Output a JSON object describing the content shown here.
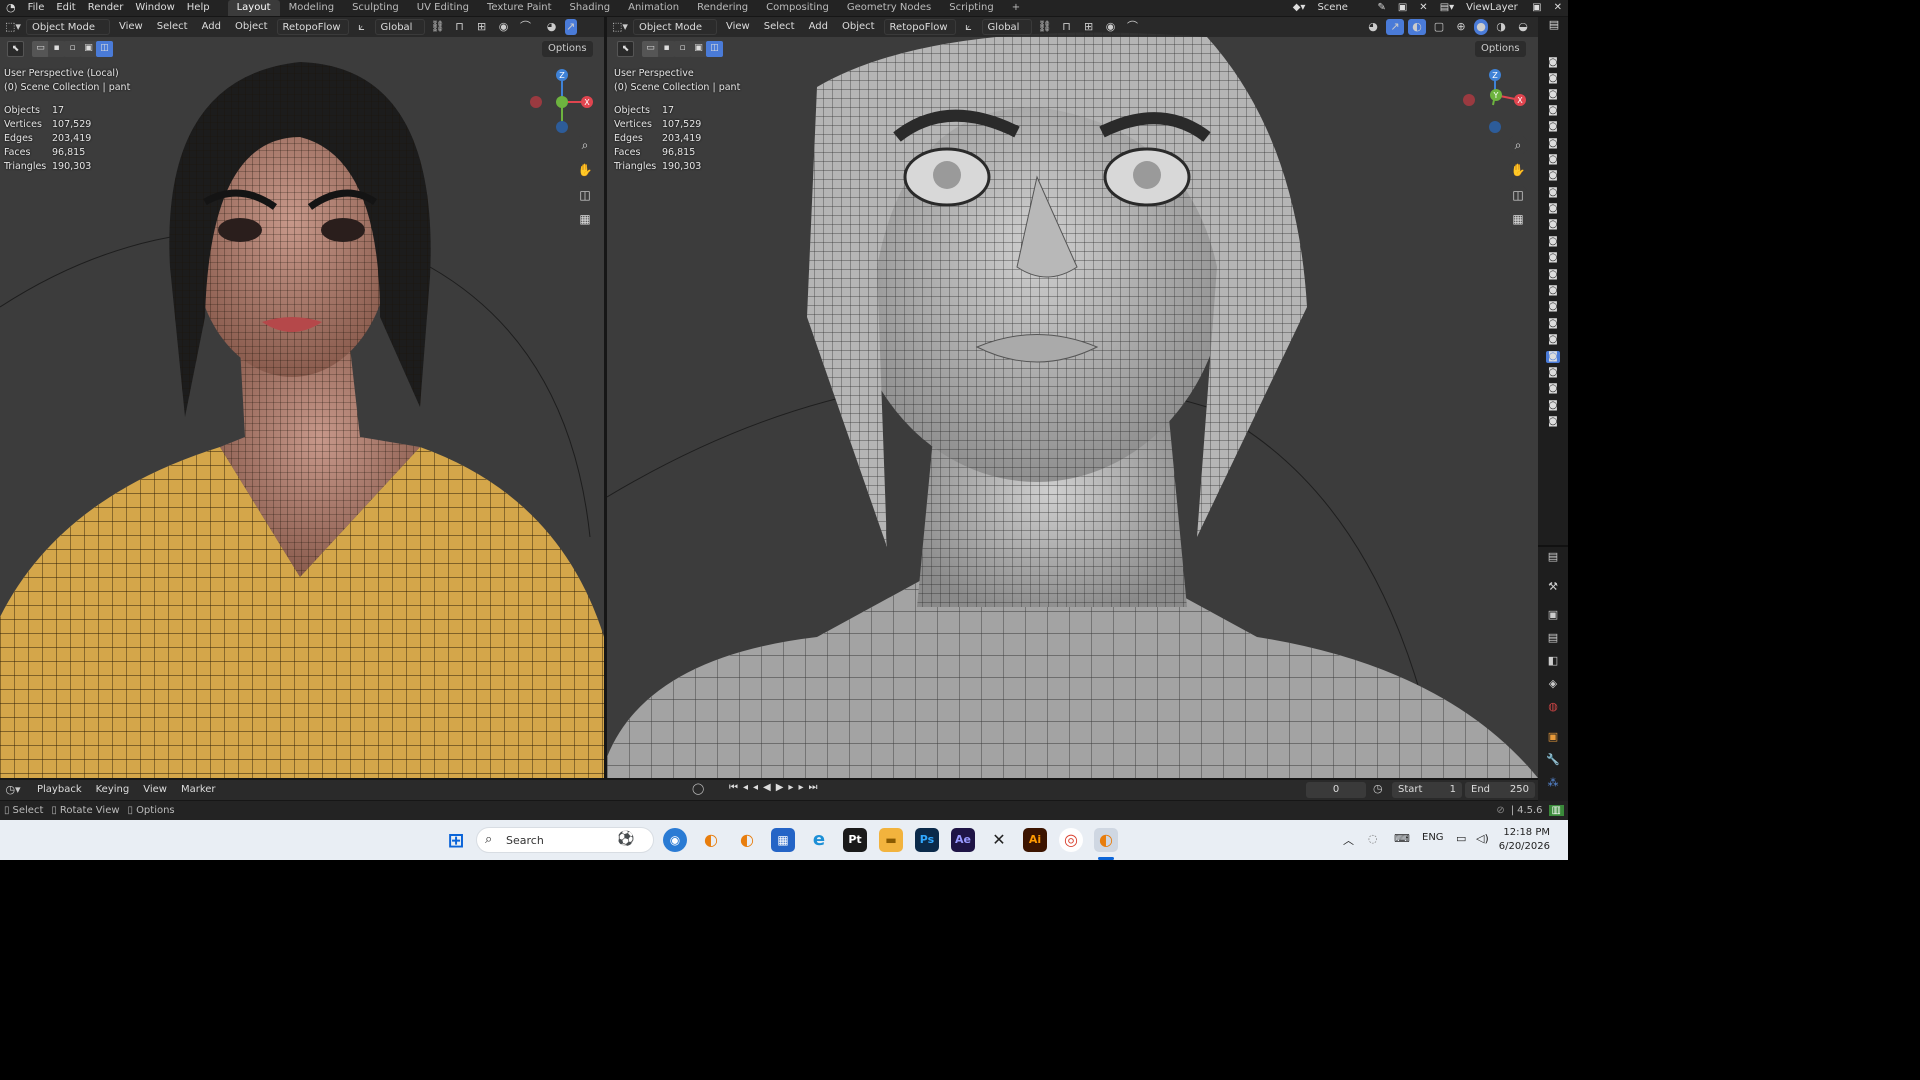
{
  "menu": {
    "items": [
      "File",
      "Edit",
      "Render",
      "Window",
      "Help"
    ],
    "workspaces": [
      "Layout",
      "Modeling",
      "Sculpting",
      "UV Editing",
      "Texture Paint",
      "Shading",
      "Animation",
      "Rendering",
      "Compositing",
      "Geometry Nodes",
      "Scripting"
    ],
    "active_workspace": "Layout",
    "scene_label": "Scene",
    "viewlayer_label": "ViewLayer"
  },
  "viewport_left": {
    "mode": "Object Mode",
    "menus": [
      "View",
      "Select",
      "Add",
      "Object"
    ],
    "addon": "RetopoFlow",
    "orientation": "Global",
    "options": "Options",
    "perspective": "User Perspective (Local)",
    "collection": "(0) Scene Collection | pant",
    "stats": [
      {
        "k": "Objects",
        "v": "17"
      },
      {
        "k": "Vertices",
        "v": "107,529"
      },
      {
        "k": "Edges",
        "v": "203,419"
      },
      {
        "k": "Faces",
        "v": "96,815"
      },
      {
        "k": "Triangles",
        "v": "190,303"
      }
    ]
  },
  "viewport_right": {
    "mode": "Object Mode",
    "menus": [
      "View",
      "Select",
      "Add",
      "Object"
    ],
    "addon": "RetopoFlow",
    "orientation": "Global",
    "options": "Options",
    "perspective": "User Perspective",
    "collection": "(0) Scene Collection | pant",
    "stats": [
      {
        "k": "Objects",
        "v": "17"
      },
      {
        "k": "Vertices",
        "v": "107,529"
      },
      {
        "k": "Edges",
        "v": "203,419"
      },
      {
        "k": "Faces",
        "v": "96,815"
      },
      {
        "k": "Triangles",
        "v": "190,303"
      }
    ]
  },
  "gizmo_axes": {
    "z": "Z",
    "y": "Y",
    "x": "X"
  },
  "timeline": {
    "menus": [
      "Playback",
      "Keying",
      "View",
      "Marker"
    ],
    "current_frame": "0",
    "start_label": "Start",
    "start": "1",
    "end_label": "End",
    "end": "250"
  },
  "statusbar": {
    "hints": [
      "Select",
      "Rotate View",
      "Options"
    ],
    "version": "4.5.6"
  },
  "taskbar": {
    "search_placeholder": "Search",
    "apps": [
      {
        "name": "start",
        "glyph": "⊞",
        "color": "#0a64d8"
      },
      {
        "name": "app1",
        "glyph": "◉",
        "color": "#2a7bd4"
      },
      {
        "name": "blender",
        "glyph": "◐",
        "color": "#e87d0d"
      },
      {
        "name": "blender2",
        "glyph": "◐",
        "color": "#e87d0d"
      },
      {
        "name": "store",
        "glyph": "▦",
        "color": "#2464c6"
      },
      {
        "name": "edge",
        "glyph": "e",
        "color": "#1c8fd6"
      },
      {
        "name": "pycharm",
        "glyph": "Pt",
        "color": "#1a1a1a"
      },
      {
        "name": "explorer",
        "glyph": "▬",
        "color": "#f2b33d"
      },
      {
        "name": "photoshop",
        "glyph": "Ps",
        "color": "#0b2a4a"
      },
      {
        "name": "aftereffects",
        "glyph": "Ae",
        "color": "#1f1446"
      },
      {
        "name": "xapp",
        "glyph": "✕",
        "color": "#222222"
      },
      {
        "name": "illustrator",
        "glyph": "Ai",
        "color": "#3c1400"
      },
      {
        "name": "chrome",
        "glyph": "◎",
        "color": "#d9412f"
      },
      {
        "name": "blender3",
        "glyph": "◐",
        "color": "#e87d0d"
      }
    ],
    "lang": "ENG",
    "time": "12:18 PM",
    "date": "6/20/2026"
  },
  "colors": {
    "axis_x": "#e0454f",
    "axis_y": "#6db33f",
    "axis_z": "#3f82d6",
    "sweater": "#d6a44a",
    "skin": "#b98a76",
    "accent": "#4a7bd8"
  }
}
